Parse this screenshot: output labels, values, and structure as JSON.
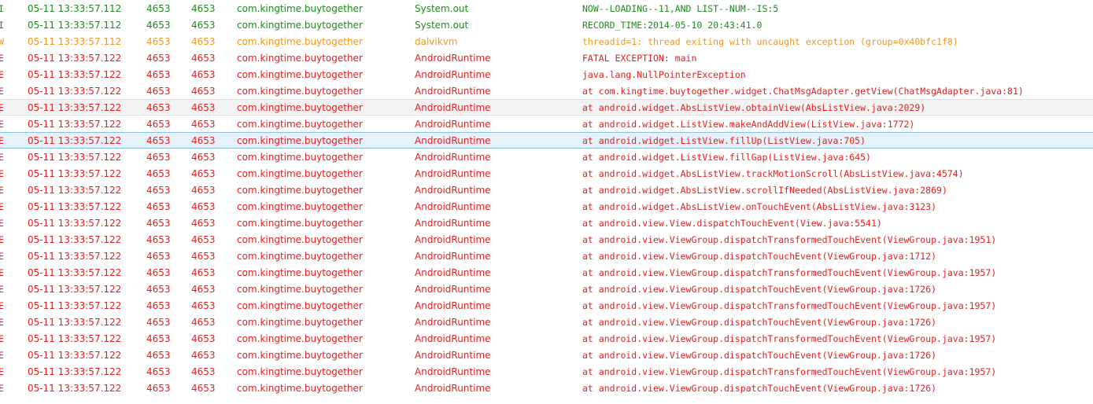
{
  "logcat": {
    "colors": {
      "I": "#1f8a1f",
      "W": "#f0961e",
      "E": "#e02020",
      "selected_bg": "#e5f2fb",
      "hovered_bg": "#f3f3f3"
    },
    "rows": [
      {
        "level": "I",
        "time": "05-11 13:33:57.112",
        "pid": "4653",
        "tid": "4653",
        "app": "com.kingtime.buytogether",
        "tag": "System.out",
        "text": "NOW--LOADING--11,AND LIST--NUM--IS:5"
      },
      {
        "level": "I",
        "time": "05-11 13:33:57.112",
        "pid": "4653",
        "tid": "4653",
        "app": "com.kingtime.buytogether",
        "tag": "System.out",
        "text": "RECORD_TIME:2014-05-10 20:43:41.0"
      },
      {
        "level": "W",
        "time": "05-11 13:33:57.112",
        "pid": "4653",
        "tid": "4653",
        "app": "com.kingtime.buytogether",
        "tag": "dalvikvm",
        "text": "threadid=1: thread exiting with uncaught exception (group=0x40bfc1f8)"
      },
      {
        "level": "E",
        "time": "05-11 13:33:57.122",
        "pid": "4653",
        "tid": "4653",
        "app": "com.kingtime.buytogether",
        "tag": "AndroidRuntime",
        "text": "FATAL EXCEPTION: main"
      },
      {
        "level": "E",
        "time": "05-11 13:33:57.122",
        "pid": "4653",
        "tid": "4653",
        "app": "com.kingtime.buytogether",
        "tag": "AndroidRuntime",
        "text": "java.lang.NullPointerException"
      },
      {
        "level": "E",
        "time": "05-11 13:33:57.122",
        "pid": "4653",
        "tid": "4653",
        "app": "com.kingtime.buytogether",
        "tag": "AndroidRuntime",
        "text": "at com.kingtime.buytogether.widget.ChatMsgAdapter.getView(ChatMsgAdapter.java:81)"
      },
      {
        "level": "E",
        "time": "05-11 13:33:57.122",
        "pid": "4653",
        "tid": "4653",
        "app": "com.kingtime.buytogether",
        "tag": "AndroidRuntime",
        "text": "at android.widget.AbsListView.obtainView(AbsListView.java:2029)",
        "state": "hovered"
      },
      {
        "level": "E",
        "time": "05-11 13:33:57.122",
        "pid": "4653",
        "tid": "4653",
        "app": "com.kingtime.buytogether",
        "tag": "AndroidRuntime",
        "text": "at android.widget.ListView.makeAndAddView(ListView.java:1772)"
      },
      {
        "level": "E",
        "time": "05-11 13:33:57.122",
        "pid": "4653",
        "tid": "4653",
        "app": "com.kingtime.buytogether",
        "tag": "AndroidRuntime",
        "text": "at android.widget.ListView.fillUp(ListView.java:705)",
        "state": "selected"
      },
      {
        "level": "E",
        "time": "05-11 13:33:57.122",
        "pid": "4653",
        "tid": "4653",
        "app": "com.kingtime.buytogether",
        "tag": "AndroidRuntime",
        "text": "at android.widget.ListView.fillGap(ListView.java:645)"
      },
      {
        "level": "E",
        "time": "05-11 13:33:57.122",
        "pid": "4653",
        "tid": "4653",
        "app": "com.kingtime.buytogether",
        "tag": "AndroidRuntime",
        "text": "at android.widget.AbsListView.trackMotionScroll(AbsListView.java:4574)"
      },
      {
        "level": "E",
        "time": "05-11 13:33:57.122",
        "pid": "4653",
        "tid": "4653",
        "app": "com.kingtime.buytogether",
        "tag": "AndroidRuntime",
        "text": "at android.widget.AbsListView.scrollIfNeeded(AbsListView.java:2869)"
      },
      {
        "level": "E",
        "time": "05-11 13:33:57.122",
        "pid": "4653",
        "tid": "4653",
        "app": "com.kingtime.buytogether",
        "tag": "AndroidRuntime",
        "text": "at android.widget.AbsListView.onTouchEvent(AbsListView.java:3123)"
      },
      {
        "level": "E",
        "time": "05-11 13:33:57.122",
        "pid": "4653",
        "tid": "4653",
        "app": "com.kingtime.buytogether",
        "tag": "AndroidRuntime",
        "text": "at android.view.View.dispatchTouchEvent(View.java:5541)"
      },
      {
        "level": "E",
        "time": "05-11 13:33:57.122",
        "pid": "4653",
        "tid": "4653",
        "app": "com.kingtime.buytogether",
        "tag": "AndroidRuntime",
        "text": "at android.view.ViewGroup.dispatchTransformedTouchEvent(ViewGroup.java:1951)"
      },
      {
        "level": "E",
        "time": "05-11 13:33:57.122",
        "pid": "4653",
        "tid": "4653",
        "app": "com.kingtime.buytogether",
        "tag": "AndroidRuntime",
        "text": "at android.view.ViewGroup.dispatchTouchEvent(ViewGroup.java:1712)"
      },
      {
        "level": "E",
        "time": "05-11 13:33:57.122",
        "pid": "4653",
        "tid": "4653",
        "app": "com.kingtime.buytogether",
        "tag": "AndroidRuntime",
        "text": "at android.view.ViewGroup.dispatchTransformedTouchEvent(ViewGroup.java:1957)"
      },
      {
        "level": "E",
        "time": "05-11 13:33:57.122",
        "pid": "4653",
        "tid": "4653",
        "app": "com.kingtime.buytogether",
        "tag": "AndroidRuntime",
        "text": "at android.view.ViewGroup.dispatchTouchEvent(ViewGroup.java:1726)"
      },
      {
        "level": "E",
        "time": "05-11 13:33:57.122",
        "pid": "4653",
        "tid": "4653",
        "app": "com.kingtime.buytogether",
        "tag": "AndroidRuntime",
        "text": "at android.view.ViewGroup.dispatchTransformedTouchEvent(ViewGroup.java:1957)"
      },
      {
        "level": "E",
        "time": "05-11 13:33:57.122",
        "pid": "4653",
        "tid": "4653",
        "app": "com.kingtime.buytogether",
        "tag": "AndroidRuntime",
        "text": "at android.view.ViewGroup.dispatchTouchEvent(ViewGroup.java:1726)"
      },
      {
        "level": "E",
        "time": "05-11 13:33:57.122",
        "pid": "4653",
        "tid": "4653",
        "app": "com.kingtime.buytogether",
        "tag": "AndroidRuntime",
        "text": "at android.view.ViewGroup.dispatchTransformedTouchEvent(ViewGroup.java:1957)"
      },
      {
        "level": "E",
        "time": "05-11 13:33:57.122",
        "pid": "4653",
        "tid": "4653",
        "app": "com.kingtime.buytogether",
        "tag": "AndroidRuntime",
        "text": "at android.view.ViewGroup.dispatchTouchEvent(ViewGroup.java:1726)"
      },
      {
        "level": "E",
        "time": "05-11 13:33:57.122",
        "pid": "4653",
        "tid": "4653",
        "app": "com.kingtime.buytogether",
        "tag": "AndroidRuntime",
        "text": "at android.view.ViewGroup.dispatchTransformedTouchEvent(ViewGroup.java:1957)"
      },
      {
        "level": "E",
        "time": "05-11 13:33:57.122",
        "pid": "4653",
        "tid": "4653",
        "app": "com.kingtime.buytogether",
        "tag": "AndroidRuntime",
        "text": "at android.view.ViewGroup.dispatchTouchEvent(ViewGroup.java:1726)"
      }
    ]
  }
}
